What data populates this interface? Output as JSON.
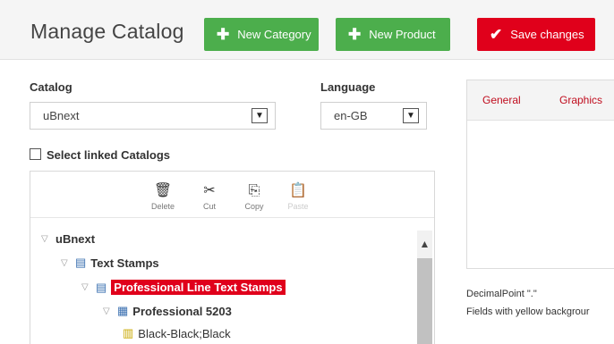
{
  "header": {
    "title": "Manage Catalog",
    "new_category": "New Category",
    "new_product": "New Product",
    "save_changes": "Save changes"
  },
  "form": {
    "catalog_label": "Catalog",
    "catalog_value": "uBnext",
    "language_label": "Language",
    "language_value": "en-GB",
    "select_linked_label": "Select linked Catalogs",
    "select_linked_checked": false
  },
  "toolbar": {
    "delete": "Delete",
    "cut": "Cut",
    "copy": "Copy",
    "paste": "Paste"
  },
  "tree": {
    "root": "uBnext",
    "text_stamps": "Text Stamps",
    "professional_line": "Professional Line Text Stamps",
    "professional_5203": "Professional 5203",
    "variant": "Black-Black;Black"
  },
  "right": {
    "tab_general": "General",
    "tab_graphics": "Graphics",
    "decimal_point": "DecimalPoint \".\"",
    "fields_note": "Fields with yellow backgrour"
  },
  "icons": {
    "new_category": "plus-icon",
    "new_product": "plus-icon",
    "save": "checkmark-icon",
    "delete": "trash-icon",
    "cut": "scissors-icon",
    "copy": "copy-icon",
    "paste": "paste-icon",
    "dropdown": "chevron-down-icon",
    "tree_expand": "chevron-down-icon",
    "catalog_node": "list-icon",
    "product_node": "grid-icon",
    "variant_node": "barcode-icon",
    "scroll_up": "chevron-up-icon"
  },
  "colors": {
    "green": "#4cae4c",
    "red": "#e0001b",
    "tab_text": "#c00d1e"
  }
}
